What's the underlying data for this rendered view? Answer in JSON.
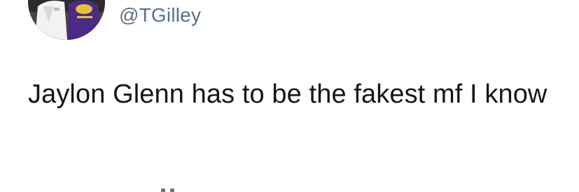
{
  "tweet": {
    "handle": "@TGilley",
    "text": "Jaylon Glenn has to be the fakest mf I know",
    "avatar_icon": "profile-photo-avatar"
  }
}
